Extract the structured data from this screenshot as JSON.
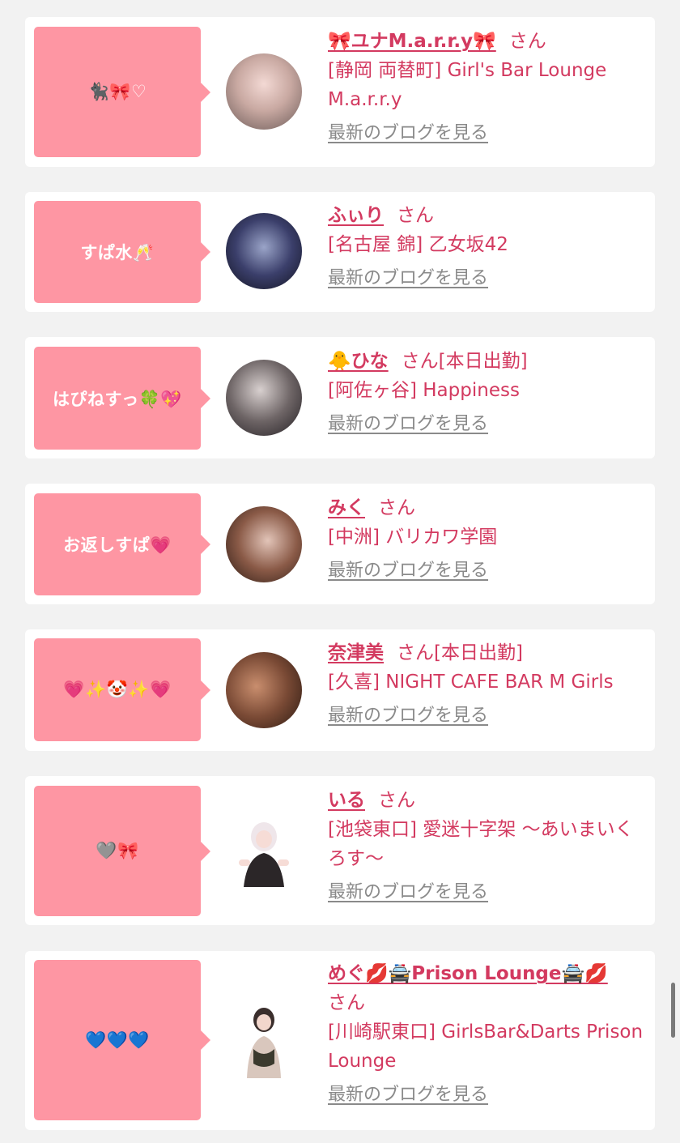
{
  "blog_link_label": "最新のブログを見る",
  "san_label": "さん",
  "entries": [
    {
      "title": "🐈‍⬛🎀♡",
      "name": "🎀ユナM.a.r.r.y🎀",
      "status": "",
      "shop": "[静岡 両替町] Girl's Bar Lounge M.a.r.r.y"
    },
    {
      "title": "すぱ水🥂",
      "name": "ふぃり",
      "status": "",
      "shop": "[名古屋 錦] 乙女坂42"
    },
    {
      "title": "はぴねすっ🍀💖",
      "name": "🐥ひな",
      "status": "[本日出勤]",
      "shop": "[阿佐ヶ谷] Happiness"
    },
    {
      "title": "お返しすぱ💗",
      "name": "みく",
      "status": "",
      "shop": "[中洲] バリカワ学園"
    },
    {
      "title": "💗✨🤡✨💗",
      "name": "奈津美",
      "status": "[本日出勤]",
      "shop": "[久喜] NIGHT CAFE BAR M Girls"
    },
    {
      "title": "🩶🎀",
      "name": "いる",
      "status": "",
      "shop": "[池袋東口] 愛迷十字架 〜あいまいくろす〜"
    },
    {
      "title": "💙💙💙",
      "name": "めぐ💋🚔Prison Lounge🚔💋",
      "status": "",
      "shop": "[川崎駅東口] GirlsBar&Darts Prison Lounge"
    }
  ],
  "colors": {
    "accent": "#d33a60",
    "bubble": "#fe96a3",
    "background": "#f2f2f2",
    "card": "#ffffff",
    "link_gray": "#8a8a8a"
  }
}
